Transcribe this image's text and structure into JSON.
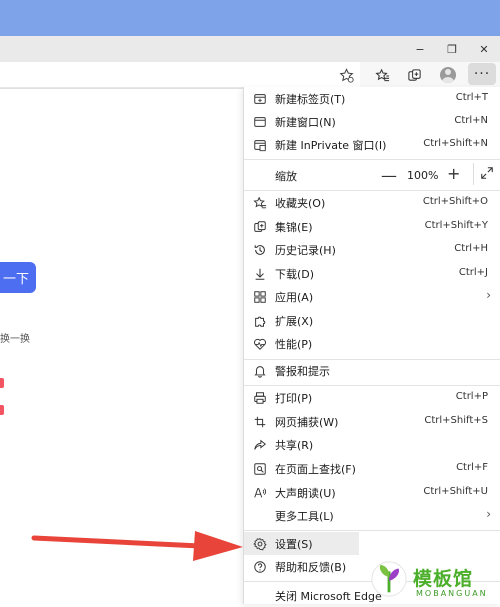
{
  "window": {
    "minimize_glyph": "−",
    "restore_glyph": "❐",
    "close_glyph": "✕"
  },
  "toolbar": {
    "more_glyph": "···"
  },
  "page": {
    "search_button": "一下",
    "swap_text": "换一换"
  },
  "menu": {
    "items": [
      {
        "name": "new-tab",
        "icon": "new-tab-icon",
        "label": "新建标签页(T)",
        "shortcut": "Ctrl+T"
      },
      {
        "name": "new-window",
        "icon": "new-window-icon",
        "label": "新建窗口(N)",
        "shortcut": "Ctrl+N"
      },
      {
        "name": "new-inprivate",
        "icon": "inprivate-icon",
        "label": "新建 InPrivate 窗口(I)",
        "shortcut": "Ctrl+Shift+N"
      },
      {
        "name": "favorites",
        "icon": "favorites-icon",
        "label": "收藏夹(O)",
        "shortcut": "Ctrl+Shift+O"
      },
      {
        "name": "collections",
        "icon": "collections-icon",
        "label": "集锦(E)",
        "shortcut": "Ctrl+Shift+Y"
      },
      {
        "name": "history",
        "icon": "history-icon",
        "label": "历史记录(H)",
        "shortcut": "Ctrl+H"
      },
      {
        "name": "downloads",
        "icon": "download-icon",
        "label": "下载(D)",
        "shortcut": "Ctrl+J"
      },
      {
        "name": "apps",
        "icon": "apps-icon",
        "label": "应用(A)",
        "shortcut": ""
      },
      {
        "name": "extensions",
        "icon": "extensions-icon",
        "label": "扩展(X)",
        "shortcut": ""
      },
      {
        "name": "performance",
        "icon": "performance-icon",
        "label": "性能(P)",
        "shortcut": ""
      },
      {
        "name": "alerts",
        "icon": "bell-icon",
        "label": "警报和提示",
        "shortcut": ""
      },
      {
        "name": "print",
        "icon": "printer-icon",
        "label": "打印(P)",
        "shortcut": "Ctrl+P"
      },
      {
        "name": "web-capture",
        "icon": "web-capture-icon",
        "label": "网页捕获(W)",
        "shortcut": "Ctrl+Shift+S"
      },
      {
        "name": "share",
        "icon": "share-icon",
        "label": "共享(R)",
        "shortcut": ""
      },
      {
        "name": "find",
        "icon": "find-icon",
        "label": "在页面上查找(F)",
        "shortcut": "Ctrl+F"
      },
      {
        "name": "read-aloud",
        "icon": "read-aloud-icon",
        "label": "大声朗读(U)",
        "shortcut": "Ctrl+Shift+U"
      },
      {
        "name": "more-tools",
        "icon": "",
        "label": "更多工具(L)",
        "shortcut": ""
      },
      {
        "name": "settings",
        "icon": "gear-icon",
        "label": "设置(S)",
        "shortcut": ""
      },
      {
        "name": "help",
        "icon": "help-icon",
        "label": "帮助和反馈(B)",
        "shortcut": ""
      },
      {
        "name": "close-edge",
        "icon": "",
        "label": "关闭 Microsoft Edge",
        "shortcut": ""
      }
    ],
    "zoom": {
      "label": "缩放",
      "minus": "—",
      "value": "100%",
      "plus": "+"
    },
    "submenu_chevron": "›"
  },
  "watermark": {
    "cn": "模板馆",
    "en": "MOBANGUAN"
  },
  "colors": {
    "top_band": "#7ea3e9",
    "arrow": "#e8443a",
    "search_button": "#4e6ef2",
    "watermark_green": "#4caf2b"
  }
}
